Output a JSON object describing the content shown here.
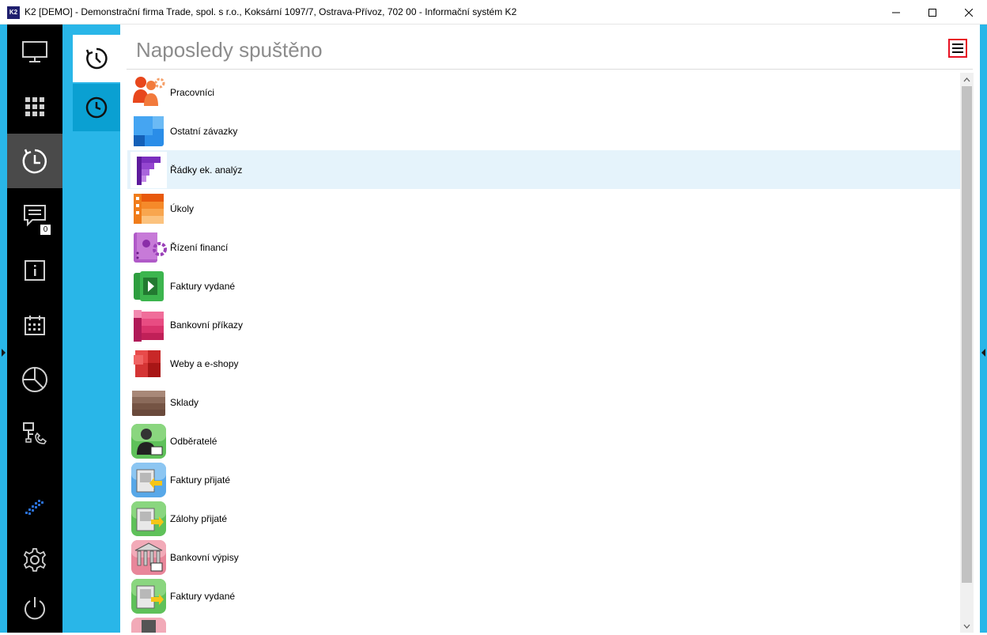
{
  "window": {
    "title": "K2 [DEMO] - Demonstrační firma Trade, spol. s r.o., Koksární 1097/7, Ostrava-Přívoz, 702 00 - Informační systém K2",
    "app_icon": "K2"
  },
  "sidebar": {
    "items": [
      {
        "icon": "monitor-icon"
      },
      {
        "icon": "grid-icon"
      },
      {
        "icon": "recent-clock-icon",
        "active": true
      },
      {
        "icon": "messages-icon",
        "badge": "0"
      },
      {
        "icon": "info-icon"
      },
      {
        "icon": "calendar-icon"
      },
      {
        "icon": "pie-chart-icon"
      },
      {
        "icon": "network-phone-icon"
      },
      {
        "icon": "k2-logo-icon"
      },
      {
        "icon": "gear-icon"
      },
      {
        "icon": "power-icon"
      }
    ]
  },
  "subtabs": [
    {
      "icon": "history-clock-icon",
      "active": true
    },
    {
      "icon": "clock-icon"
    }
  ],
  "main": {
    "title": "Naposledy spuštěno",
    "items": [
      {
        "label": "Pracovníci",
        "icon": "employees-icon"
      },
      {
        "label": "Ostatní závazky",
        "icon": "other-liabilities-icon"
      },
      {
        "label": "Řádky ek. analýz",
        "icon": "analysis-rows-icon",
        "selected": true
      },
      {
        "label": "Úkoly",
        "icon": "tasks-icon"
      },
      {
        "label": "Řízení financí",
        "icon": "finance-management-icon"
      },
      {
        "label": "Faktury vydané",
        "icon": "issued-invoices-icon"
      },
      {
        "label": "Bankovní příkazy",
        "icon": "bank-orders-icon"
      },
      {
        "label": "Weby a e-shopy",
        "icon": "web-shops-icon"
      },
      {
        "label": "Sklady",
        "icon": "warehouses-icon"
      },
      {
        "label": "Odběratelé",
        "icon": "customers-icon"
      },
      {
        "label": "Faktury přijaté",
        "icon": "received-invoices-icon"
      },
      {
        "label": "Zálohy přijaté",
        "icon": "received-advances-icon"
      },
      {
        "label": "Bankovní výpisy",
        "icon": "bank-statements-icon"
      },
      {
        "label": "Faktury vydané",
        "icon": "issued-invoices-legacy-icon"
      },
      {
        "label": "",
        "icon": "partial-item-icon"
      }
    ]
  },
  "colors": {
    "accent": "#29b6e8",
    "sidebar": "#000000",
    "selected_row": "#e5f3fb",
    "menu_highlight": "#e81123"
  }
}
